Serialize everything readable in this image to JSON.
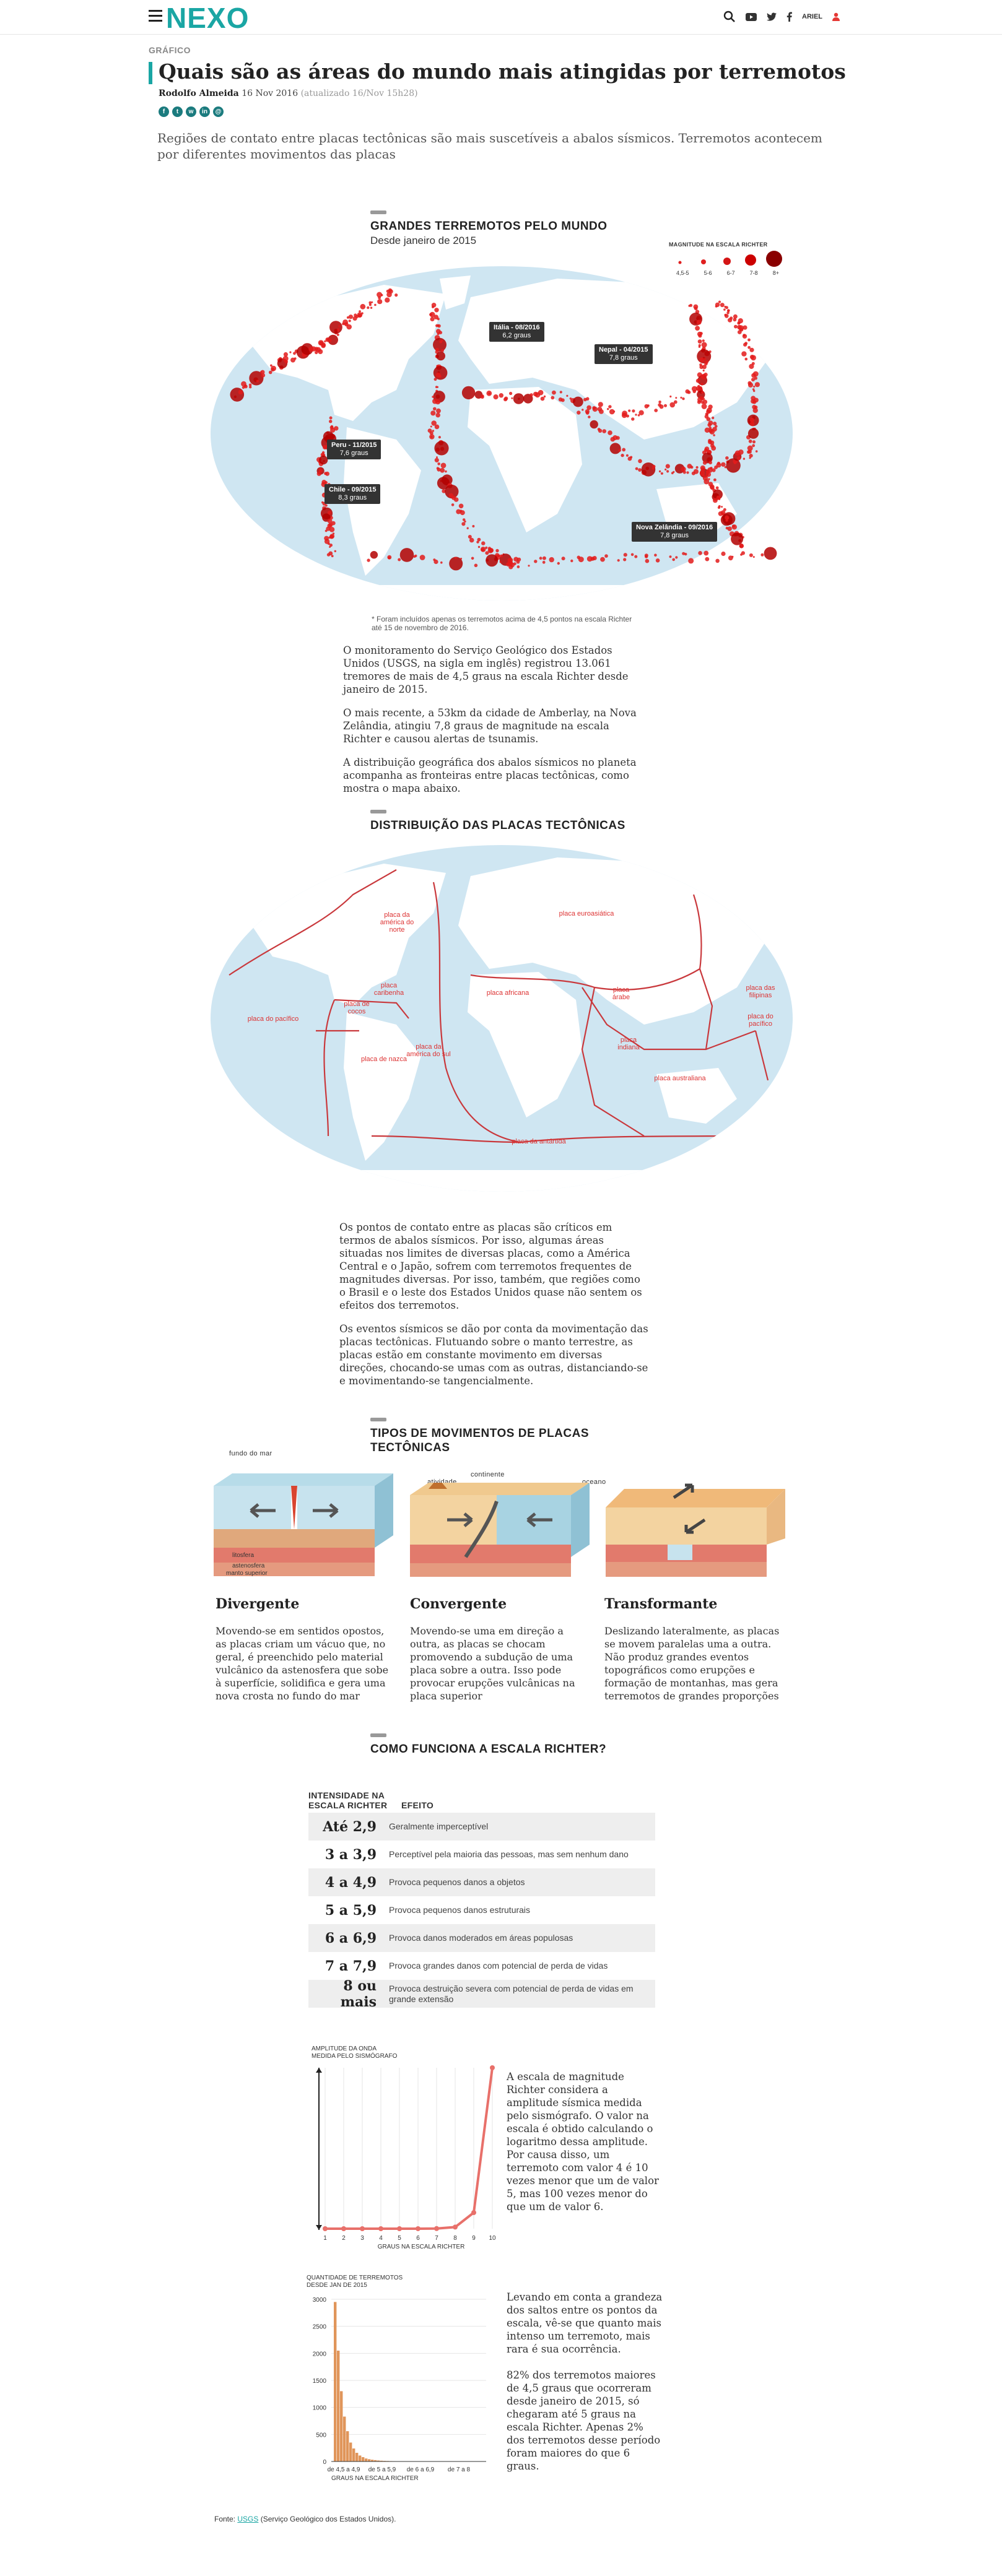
{
  "header": {
    "logo": "NEXO",
    "user": "ARIEL"
  },
  "article": {
    "kicker": "GRÁFICO",
    "title": "Quais são as áreas do mundo mais atingidas por terremotos",
    "author": "Rodolfo Almeida",
    "date": "16 Nov 2016",
    "updated": "(atualizado 16/Nov 15h28)",
    "lead": "Regiões de contato entre placas tectônicas são mais suscetíveis a abalos sísmicos. Terremotos acontecem por diferentes movimentos das placas"
  },
  "share_icons": [
    "facebook-icon",
    "twitter-icon",
    "whatsapp-icon",
    "linkedin-icon",
    "email-icon"
  ],
  "map1": {
    "title": "GRANDES TERREMOTOS PELO MUNDO",
    "subtitle": "Desde janeiro de 2015",
    "legend_title": "MAGNITUDE NA ESCALA RICHTER",
    "legend": [
      "4,5-5",
      "5-6",
      "6-7",
      "7-8",
      "8+"
    ],
    "callouts": [
      {
        "place": "Itália - 08/2016",
        "mag": "6,2 graus"
      },
      {
        "place": "Nepal - 04/2015",
        "mag": "7,8 graus"
      },
      {
        "place": "Peru - 11/2015",
        "mag": "7,6 graus"
      },
      {
        "place": "Chile - 09/2015",
        "mag": "8,3 graus"
      },
      {
        "place": "Nova Zelândia - 09/2016",
        "mag": "7,8 graus"
      }
    ],
    "note": "* Foram incluídos apenas os terremotos acima de 4,5 pontos na escala Richter até 15 de novembro de 2016."
  },
  "text1": [
    "O monitoramento do Serviço Geológico dos Estados Unidos (USGS, na sigla em inglês) registrou 13.061 tremores de mais de 4,5 graus na escala Richter desde janeiro de 2015.",
    "O mais recente, a 53km da cidade de Amberlay, na Nova Zelândia, atingiu 7,8 graus de magnitude na escala Richter e causou alertas de tsunamis.",
    "A distribuição geográfica dos abalos sísmicos no planeta acompanha as fronteiras entre placas tectônicas, como mostra o mapa abaixo."
  ],
  "map2": {
    "title": "DISTRIBUIÇÃO DAS PLACAS TECTÔNICAS",
    "plates": [
      "placa da américa do norte",
      "placa euroasiática",
      "placa do pacífico",
      "placa caribenha",
      "placa de cocos",
      "placa africana",
      "placa árabe",
      "placa indiana",
      "placa das filipinas",
      "placa do pacífico",
      "placa de nazca",
      "placa da américa do sul",
      "placa australiana",
      "placa da antártida"
    ]
  },
  "text2": [
    "Os pontos de contato entre as placas são críticos em termos de abalos sísmicos. Por isso, algumas áreas situadas nos limites de diversas placas, como a América Central e o Japão, sofrem com terremotos frequentes de magnitudes diversas. Por isso, também, que regiões como o Brasil e o leste dos Estados Unidos quase não sentem os efeitos dos terremotos.",
    "Os eventos sísmicos se dão por conta da movimentação das placas tectônicas. Flutuando sobre o manto terrestre, as placas estão em constante movimento em diversas direções, chocando-se umas com as outras, distanciando-se e movimentando-se tangencialmente."
  ],
  "movements": {
    "title": "TIPOS DE MOVIMENTOS DE PLACAS TECTÔNICAS",
    "labels": {
      "seafloor": "fundo do mar",
      "lithosphere": "litosfera",
      "asthenosphere": "astenosfera",
      "upper_mantle": "manto superior",
      "volcanic": "atividade vulcânica",
      "continent": "continente",
      "ocean": "oceano"
    },
    "items": [
      {
        "name": "Divergente",
        "desc": "Movendo-se em sentidos opostos, as placas criam um vácuo que, no geral, é preenchido pelo material vulcânico da astenosfera que sobe à superfície, solidifica e gera uma nova crosta no fundo do mar"
      },
      {
        "name": "Convergente",
        "desc": "Movendo-se uma em direção a outra, as placas se chocam promovendo a subdução de uma placa sobre a outra. Isso pode provocar erupções vulcânicas na placa superior"
      },
      {
        "name": "Transformante",
        "desc": "Deslizando lateralmente, as placas se movem paralelas uma a outra. Não produz grandes eventos topográficos como erupções e formação de montanhas, mas gera terremotos de grandes proporções"
      }
    ]
  },
  "richter": {
    "title": "COMO FUNCIONA A ESCALA RICHTER?",
    "col1": "INTENSIDADE NA ESCALA RICHTER",
    "col2": "EFEITO",
    "rows": [
      {
        "range": "Até 2,9",
        "effect": "Geralmente imperceptível"
      },
      {
        "range": "3 a 3,9",
        "effect": "Perceptível pela maioria das pessoas, mas sem nenhum dano"
      },
      {
        "range": "4 a 4,9",
        "effect": "Provoca pequenos danos a objetos"
      },
      {
        "range": "5 a 5,9",
        "effect": "Provoca pequenos danos estruturais"
      },
      {
        "range": "6 a 6,9",
        "effect": "Provoca danos moderados em áreas populosas"
      },
      {
        "range": "7 a 7,9",
        "effect": "Provoca grandes danos com potencial de perda de vidas"
      },
      {
        "range": "8 ou mais",
        "effect": "Provoca destruição severa com potencial de perda de vidas em grande extensão"
      }
    ]
  },
  "text3": "A escala de magnitude Richter considera a amplitude sísmica medida pelo sismógrafo. O valor na escala é obtido calculando o logaritmo dessa amplitude. Por causa disso, um terremoto com valor 4 é 10 vezes menor que um de valor 5, mas 100 vezes menor do que um de valor 6.",
  "text4": [
    "Levando em conta a grandeza dos saltos entre os pontos da escala, vê-se que quanto mais intenso um terremoto, mais rara é sua ocorrência.",
    "82% dos terremotos maiores de 4,5 graus que ocorreram desde janeiro de 2015, só chegaram até 5 graus na escala Richter. Apenas 2% dos terremotos desse período foram maiores do que 6 graus."
  ],
  "source": {
    "prefix": "Fonte: ",
    "link": "USGS",
    "suffix": " (Serviço Geológico dos Estados Unidos)."
  },
  "chart_data": [
    {
      "type": "line",
      "ylabel": "AMPLITUDE DA ONDA MEDIDA PELO SISMÓGRAFO",
      "xlabel": "GRAUS NA ESCALA RICHTER",
      "x": [
        1,
        2,
        3,
        4,
        5,
        6,
        7,
        8,
        9,
        10
      ],
      "y": [
        1e-06,
        1e-05,
        0.0001,
        0.001,
        0.01,
        0.1,
        1,
        10,
        100,
        1000
      ],
      "color": "#e8706a"
    },
    {
      "type": "bar",
      "ylabel": "QUANTIDADE DE TERREMOTOS DESDE JAN DE 2015",
      "xlabel": "GRAUS NA ESCALA RICHTER",
      "yticks": [
        0,
        500,
        1000,
        1500,
        2000,
        2500,
        3000
      ],
      "ylim": [
        0,
        3000
      ],
      "xticks": [
        "de 4,5 a 4,9",
        "de 5 a 5,9",
        "de 6 a 6,9",
        "de 7 a 8"
      ],
      "x_start": 4.5,
      "x_step": 0.1,
      "values": [
        2950,
        2050,
        1300,
        830,
        560,
        350,
        240,
        160,
        110,
        80,
        55,
        42,
        32,
        25,
        18,
        14,
        11,
        9,
        7,
        6,
        5,
        4,
        4,
        3,
        3,
        2,
        2,
        2,
        2,
        1,
        1,
        1,
        1,
        1,
        1,
        1,
        1,
        1
      ],
      "color": "#e0955a"
    }
  ]
}
